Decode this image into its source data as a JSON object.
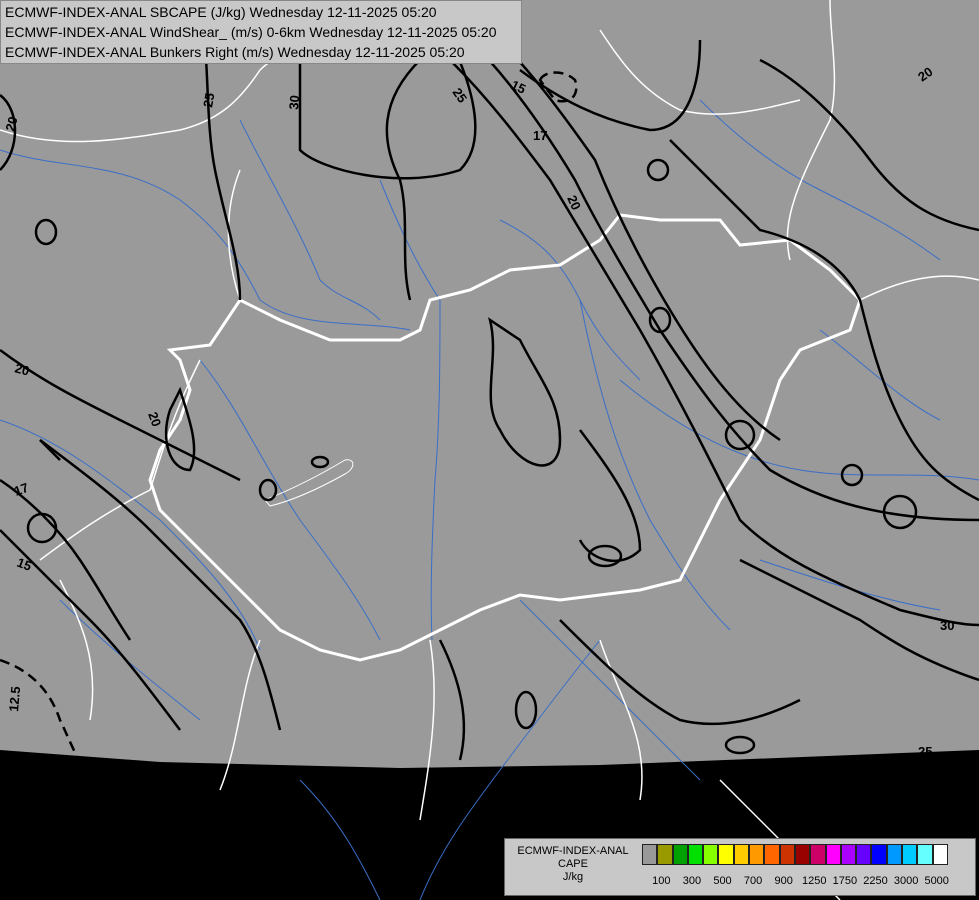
{
  "header": {
    "line1": "ECMWF-INDEX-ANAL SBCAPE (J/kg) Wednesday 12-11-2025 05:20",
    "line2": "ECMWF-INDEX-ANAL WindShear_ (m/s) 0-6km Wednesday 12-11-2025 05:20",
    "line3": "ECMWF-INDEX-ANAL Bunkers Right (m/s) Wednesday 12-11-2025 05:20"
  },
  "contour_labels": [
    {
      "text": "25"
    },
    {
      "text": "30"
    },
    {
      "text": "20"
    },
    {
      "text": "25"
    },
    {
      "text": "15"
    },
    {
      "text": "17"
    },
    {
      "text": "20"
    },
    {
      "text": "20"
    },
    {
      "text": "20"
    },
    {
      "text": "20"
    },
    {
      "text": "17"
    },
    {
      "text": "15"
    },
    {
      "text": "12.5"
    },
    {
      "text": "30"
    },
    {
      "text": "25"
    }
  ],
  "legend": {
    "title1": "ECMWF-INDEX-ANAL",
    "title2": "CAPE",
    "unit": "J/kg",
    "ticks": [
      "100",
      "300",
      "500",
      "700",
      "900",
      "1250",
      "1750",
      "2250",
      "3000",
      "5000"
    ],
    "colors": [
      "#999999",
      "#999900",
      "#00a000",
      "#00e000",
      "#88ff00",
      "#ffff00",
      "#ffcc00",
      "#ff9900",
      "#ff6600",
      "#cc3300",
      "#990000",
      "#cc0066",
      "#ff00ff",
      "#aa00ff",
      "#6600ff",
      "#0000ff",
      "#0099ff",
      "#00ccff",
      "#66ffff",
      "#ffffff"
    ]
  },
  "colors": {
    "domain_fill": "#9a9a9a",
    "background": "#000000",
    "borders": "#ffffff",
    "rivers": "#3a6ec8",
    "contours": "#000000"
  }
}
